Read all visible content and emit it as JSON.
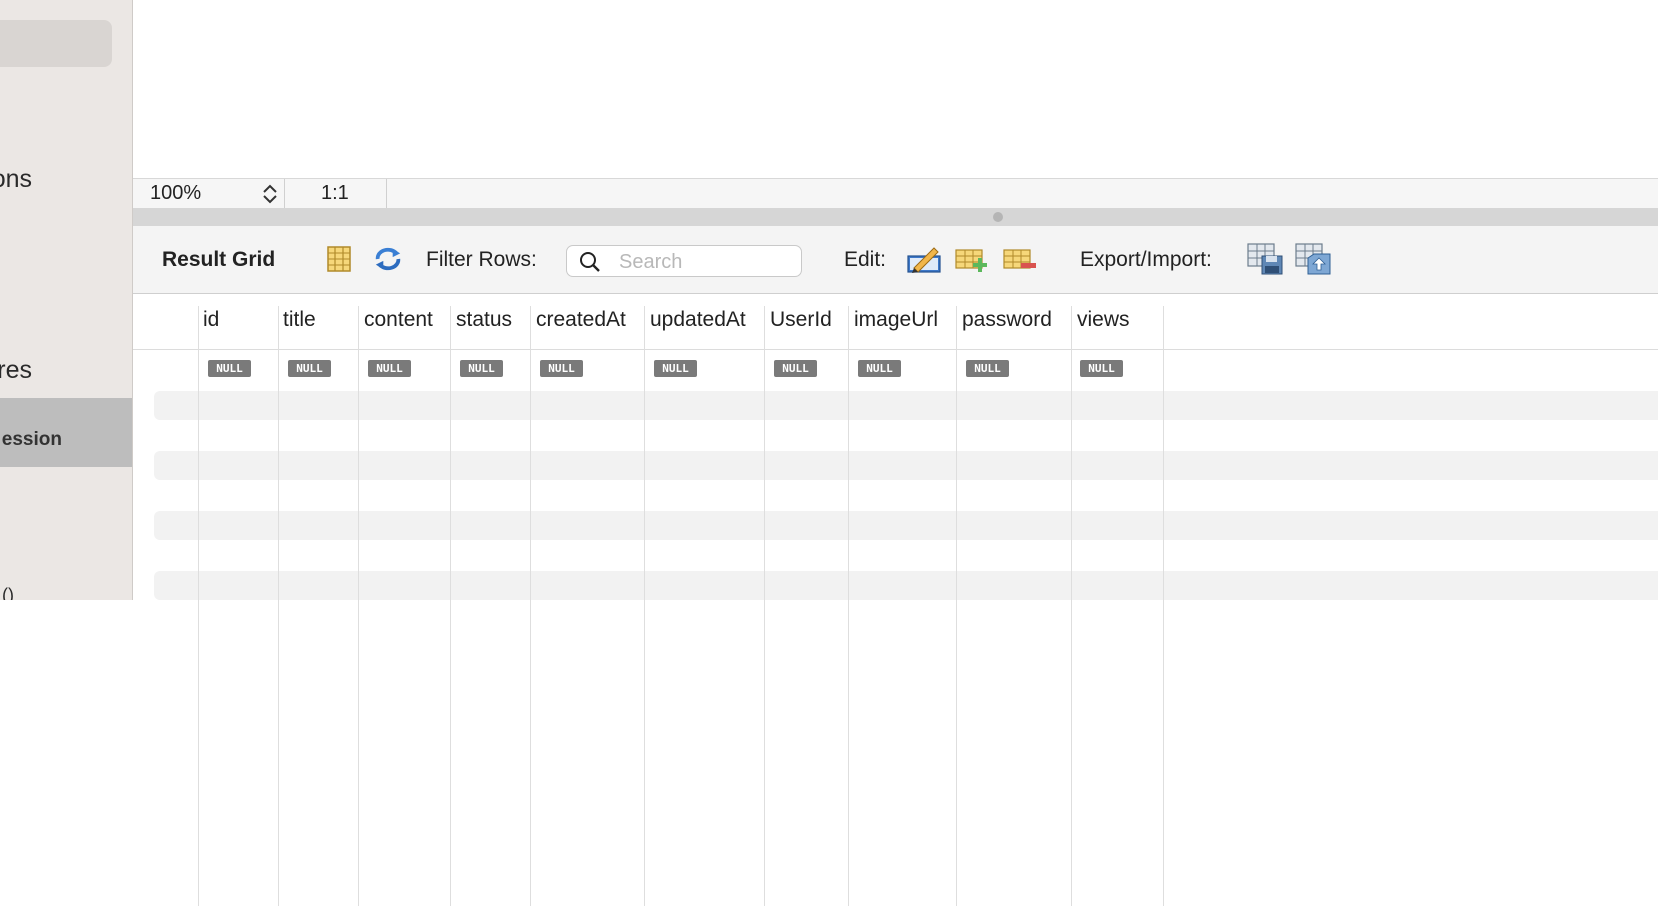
{
  "sidebar": {
    "item_fragment_1": "ons",
    "item_fragment_2": "ures",
    "selected_fragment": "ession",
    "bottom_fragment": "()"
  },
  "statusbar": {
    "zoom": "100%",
    "ratio": "1:1"
  },
  "toolbar": {
    "title": "Result Grid",
    "filter_label": "Filter Rows:",
    "search_placeholder": "Search",
    "edit_label": "Edit:",
    "export_label": "Export/Import:",
    "icons": [
      "column-toggle-icon",
      "refresh-icon",
      "edit-row-icon",
      "add-row-icon",
      "delete-row-icon",
      "export-icon",
      "import-icon"
    ]
  },
  "grid": {
    "columns": [
      "id",
      "title",
      "content",
      "status",
      "createdAt",
      "updatedAt",
      "UserId",
      "imageUrl",
      "password",
      "views"
    ],
    "null_label": "NULL",
    "rows": [
      [
        "NULL",
        "NULL",
        "NULL",
        "NULL",
        "NULL",
        "NULL",
        "NULL",
        "NULL",
        "NULL",
        "NULL"
      ]
    ]
  }
}
